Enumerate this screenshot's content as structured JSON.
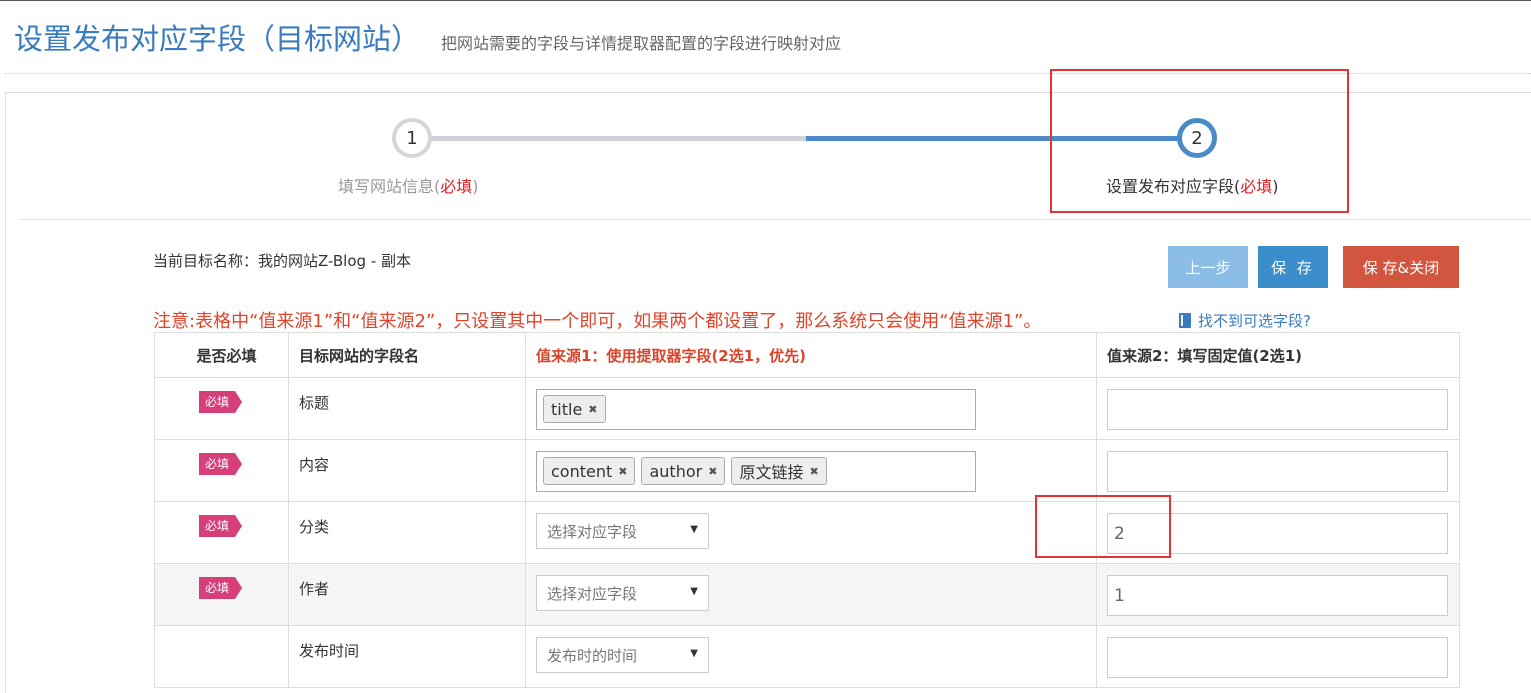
{
  "header": {
    "title": "设置发布对应字段（目标网站）",
    "subtitle": "把网站需要的字段与详情提取器配置的字段进行映射对应"
  },
  "wizard": {
    "steps": [
      {
        "number": "1",
        "label": "填写网站信息(",
        "required": "必填",
        "close": ")"
      },
      {
        "number": "2",
        "label": "设置发布对应字段(",
        "required": "必填",
        "close": ")"
      }
    ]
  },
  "target_name": "当前目标名称：我的网站Z-Blog - 副本",
  "buttons": {
    "prev": "上一步",
    "save": "保 存",
    "save_close": "保 存&关闭"
  },
  "notice": "注意:表格中“值来源1”和“值来源2”，只设置其中一个即可，如果两个都设置了，那么系统只会使用“值来源1”。",
  "help_link": "找不到可选字段?",
  "table": {
    "headers": {
      "required": "是否必填",
      "field": "目标网站的字段名",
      "source1": "值来源1：使用提取器字段(2选1，优先)",
      "source2": "值来源2：填写固定值(2选1)"
    },
    "badge": "必填",
    "rows": [
      {
        "field": "标题",
        "tags": [
          "title"
        ]
      },
      {
        "field": "内容",
        "tags": [
          "content",
          "author",
          "原文链接"
        ]
      },
      {
        "field": "分类",
        "select": "选择对应字段",
        "value": "2"
      },
      {
        "field": "作者",
        "select": "选择对应字段",
        "value": "1"
      },
      {
        "field": "发布时间",
        "select": "发布时的时间",
        "value": ""
      }
    ]
  },
  "colors": {
    "accent_blue": "#3a7bbf",
    "warning_red": "#e0442b",
    "badge_pink": "#d63f7a",
    "annotation_red": "#e83232"
  }
}
